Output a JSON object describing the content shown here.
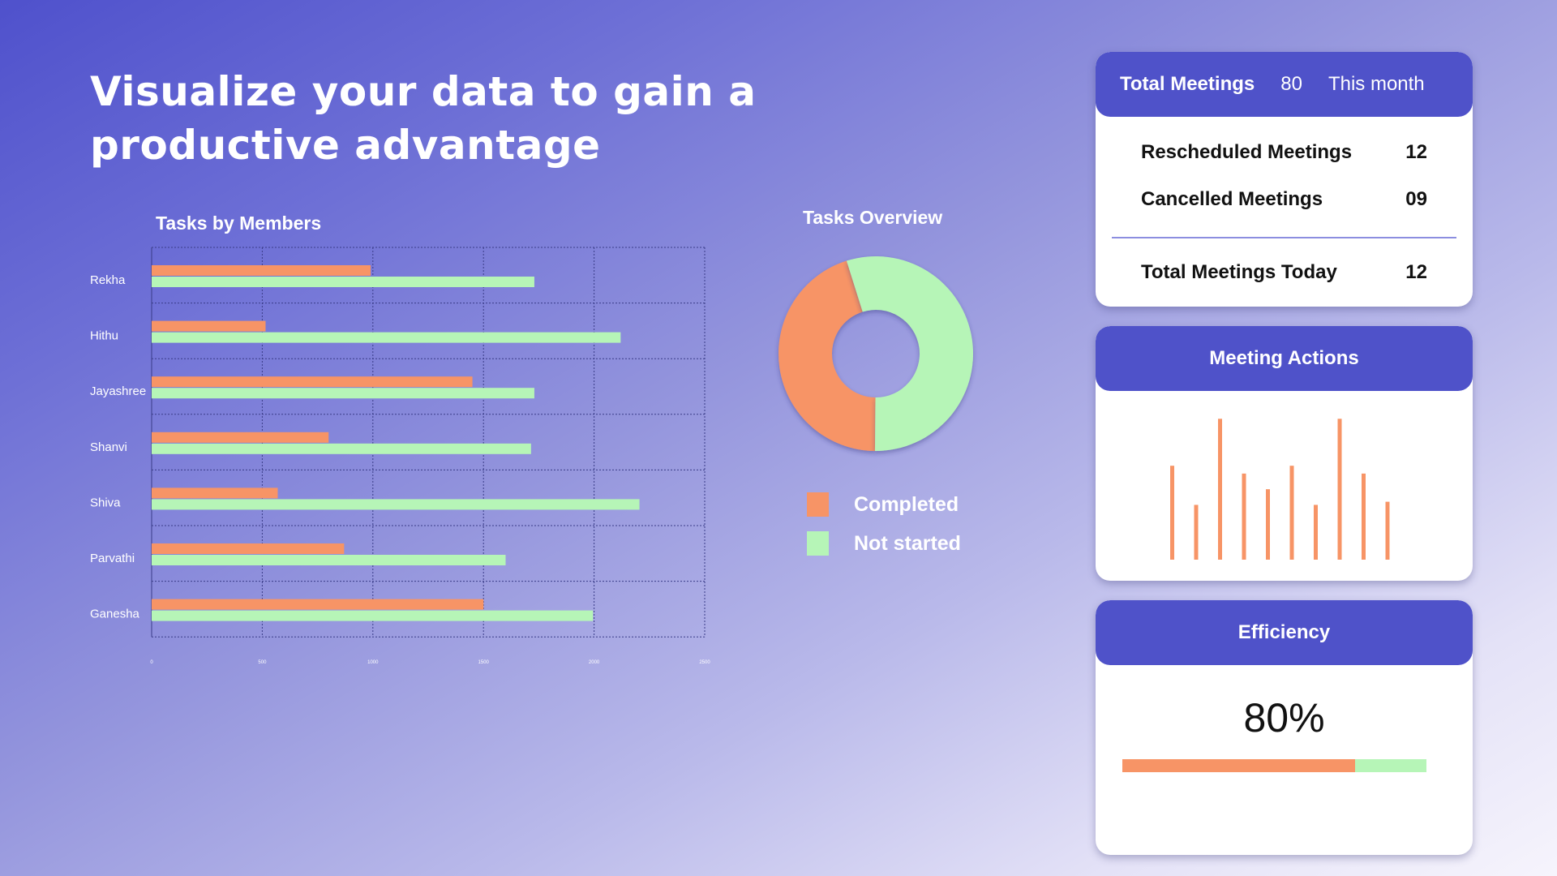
{
  "headline": "Visualize your data to gain a productive advantage",
  "colors": {
    "completed": "#f79466",
    "not_started": "#b6f5b7",
    "accent": "#4f52c9"
  },
  "chart_data": [
    {
      "type": "bar",
      "orientation": "horizontal",
      "title": "Tasks by Members",
      "categories": [
        "Rekha",
        "Hithu",
        "Jayashree",
        "Shanvi",
        "Shiva",
        "Parvathi",
        "Ganesha"
      ],
      "series": [
        {
          "values": [
            990,
            515,
            1450,
            800,
            570,
            870,
            1500
          ]
        },
        {
          "values": [
            1730,
            2120,
            1730,
            1715,
            2205,
            1600,
            1995
          ]
        }
      ],
      "x_ticks": [
        "0",
        "500",
        "1000",
        "1500",
        "2000",
        "2500"
      ],
      "xlim": [
        0,
        2500
      ],
      "grid": true
    },
    {
      "type": "pie",
      "donut": true,
      "title": "Tasks Overview",
      "labels": [
        "Completed",
        "Not started"
      ],
      "values": [
        45,
        55
      ],
      "legend": "bottom"
    },
    {
      "type": "bar",
      "title": "Meeting Actions",
      "values": [
        6,
        3.5,
        9,
        5.5,
        4.5,
        6,
        3.5,
        9,
        5.5,
        3.7
      ]
    }
  ],
  "summary": {
    "title": "Total Meetings",
    "count": "80",
    "period": "This month",
    "rows": [
      {
        "label": "Rescheduled Meetings",
        "value": "12"
      },
      {
        "label": "Cancelled Meetings",
        "value": "09"
      }
    ],
    "today_label": "Total Meetings Today",
    "today_value": "12"
  },
  "efficiency": {
    "title": "Efficiency",
    "value": "80%",
    "fraction": 0.765
  }
}
